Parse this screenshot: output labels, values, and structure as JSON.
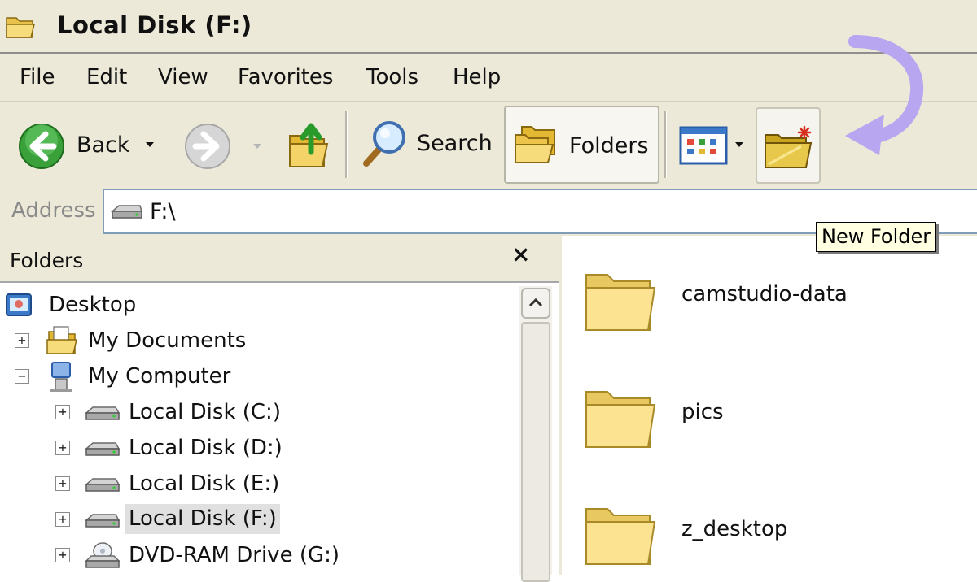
{
  "window": {
    "title": "Local Disk (F:)"
  },
  "menu": [
    "File",
    "Edit",
    "View",
    "Favorites",
    "Tools",
    "Help"
  ],
  "toolbar": {
    "back_label": "Back",
    "search_label": "Search",
    "folders_label": "Folders",
    "tooltip": "New Folder"
  },
  "address": {
    "label": "Address",
    "value": "F:\\"
  },
  "folders_pane": {
    "title": "Folders",
    "close_glyph": "×",
    "items": [
      {
        "label": "Desktop",
        "icon": "desktop-icon",
        "expander": ""
      },
      {
        "label": "My Documents",
        "icon": "my-documents-icon",
        "expander": "+"
      },
      {
        "label": "My Computer",
        "icon": "my-computer-icon",
        "expander": "−"
      },
      {
        "label": "Local Disk (C:)",
        "icon": "drive-icon",
        "expander": "+"
      },
      {
        "label": "Local Disk (D:)",
        "icon": "drive-icon",
        "expander": "+"
      },
      {
        "label": "Local Disk (E:)",
        "icon": "drive-icon",
        "expander": "+"
      },
      {
        "label": "Local Disk (F:)",
        "icon": "drive-icon",
        "expander": "+",
        "selected": true
      },
      {
        "label": "DVD-RAM Drive (G:)",
        "icon": "dvd-drive-icon",
        "expander": "+"
      }
    ]
  },
  "files": [
    {
      "name": "camstudio-data",
      "icon": "folder-icon"
    },
    {
      "name": "pics",
      "icon": "folder-icon"
    },
    {
      "name": "z_desktop",
      "icon": "folder-icon"
    }
  ],
  "colors": {
    "chrome": "#ece9d8",
    "annotation_arrow": "#b8a6f0",
    "tooltip_bg": "#ffffe1",
    "selection": "#e0e0e0"
  }
}
